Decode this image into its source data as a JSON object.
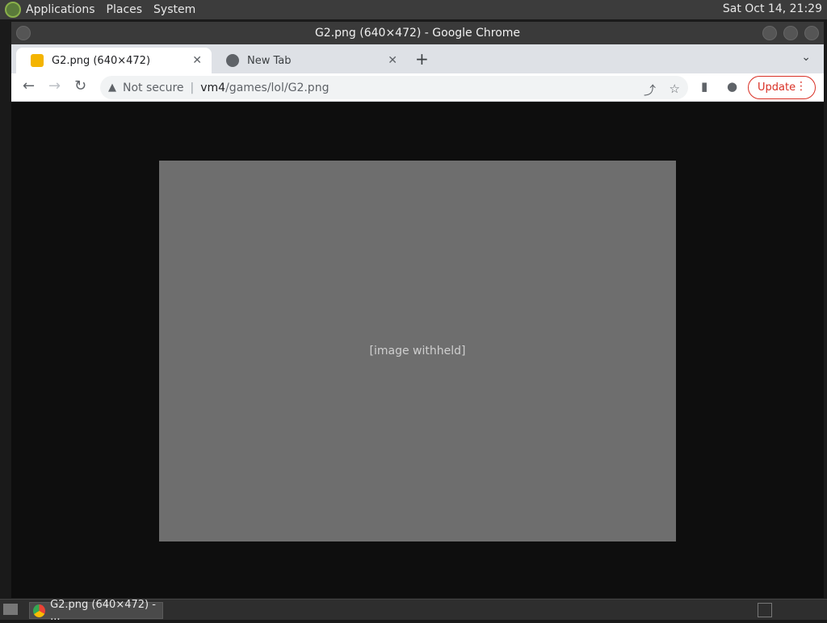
{
  "panel": {
    "menus": [
      "Applications",
      "Places",
      "System"
    ],
    "clock": "Sat Oct 14, 21:29"
  },
  "window": {
    "title": "G2.png (640×472) - Google Chrome"
  },
  "tabs": [
    {
      "label": "G2.png (640×472)",
      "icon": "image-favicon-icon"
    },
    {
      "label": "New Tab",
      "icon": "chrome-icon"
    }
  ],
  "omnibox": {
    "security": "Not secure",
    "host": "vm4",
    "path": "/games/lol/G2.png"
  },
  "toolbar": {
    "update_label": "Update"
  },
  "content": {
    "placeholder_label": "[image withheld]"
  },
  "taskbar": {
    "task_label": "G2.png (640×472) - ..."
  }
}
